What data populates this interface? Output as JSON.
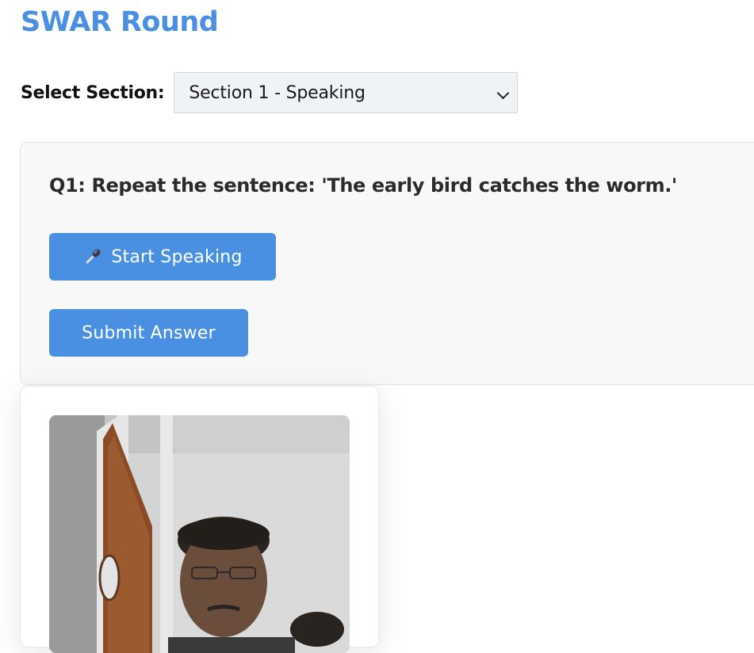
{
  "header": {
    "title": "SWAR Round"
  },
  "section_selector": {
    "label": "Select Section:",
    "selected": "Section 1 - Speaking"
  },
  "question": {
    "text": "Q1: Repeat the sentence: 'The early bird catches the worm.'"
  },
  "buttons": {
    "start_speaking_icon": "microphone-icon",
    "start_speaking": "Start Speaking",
    "submit": "Submit Answer"
  },
  "webcam": {
    "description_icon": "webcam-video-feed"
  },
  "colors": {
    "accent": "#4a90e2",
    "card_bg": "#f8f8f8",
    "select_bg": "#f0f3f6"
  }
}
